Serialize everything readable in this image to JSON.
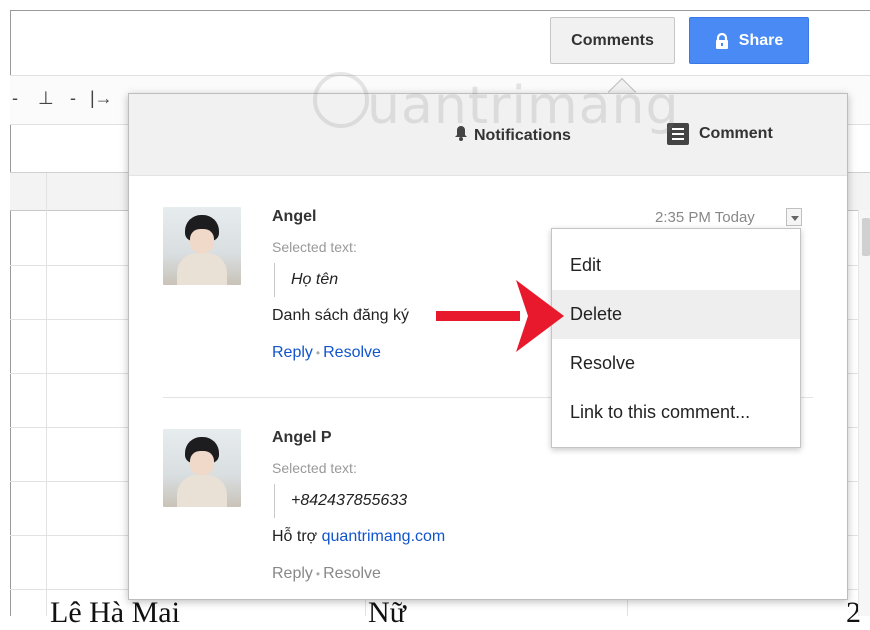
{
  "header": {
    "comments_button": "Comments",
    "share_button": "Share",
    "lock_icon": "lock-icon"
  },
  "watermark": {
    "text": "uantrimang"
  },
  "toolbar": {
    "symbols": [
      "-",
      "⊥",
      "-",
      "|→"
    ]
  },
  "sheet": {
    "row_text_1": "Lê Hà Mai",
    "row_text_2": "Nữ",
    "row_text_3": "2"
  },
  "panel": {
    "notifications_button": "Notifications",
    "comment_button": "Comment",
    "bell_icon": "bell-icon",
    "comment_icon": "comment-icon"
  },
  "comments": [
    {
      "author": "Angel",
      "selected_label": "Selected text:",
      "quote": "Họ tên",
      "body": "Danh sách đăng ký",
      "body_link": "",
      "reply": "Reply",
      "separator": "•",
      "resolve": "Resolve",
      "time": "2:35 PM Today"
    },
    {
      "author": "Angel P",
      "selected_label": "Selected text:",
      "quote": "+842437855633",
      "body": "Hỗ trợ",
      "body_link": "quantrimang.com",
      "reply": "Reply",
      "separator": "•",
      "resolve": "Resolve",
      "time": ""
    }
  ],
  "menu": {
    "items": [
      "Edit",
      "Delete",
      "Resolve",
      "Link to this comment..."
    ],
    "active_item": "Delete"
  },
  "annotation": {
    "arrow_color": "#e8192c"
  },
  "colors": {
    "share_blue": "#4a8af4",
    "link_blue": "#1155cc",
    "arrow_red": "#e8192c"
  }
}
